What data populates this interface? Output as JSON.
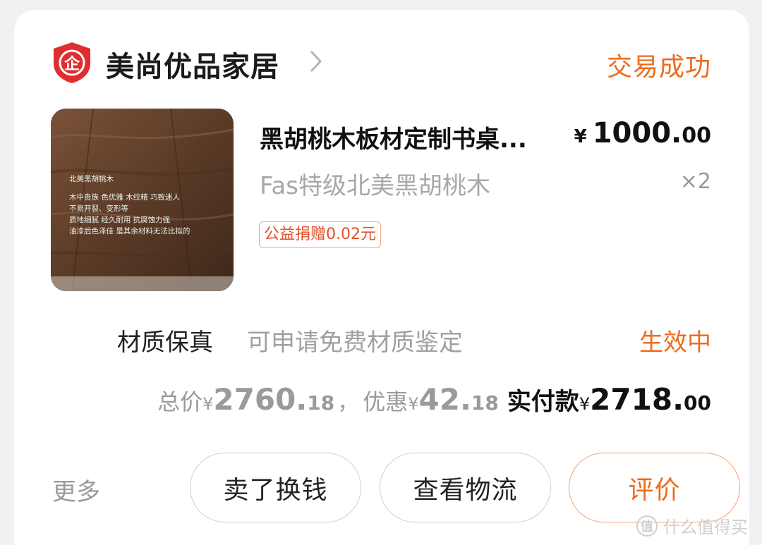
{
  "shop": {
    "name": "美尚优品家居",
    "badge_text": "企",
    "badge_color": "#e02e2e"
  },
  "order": {
    "status": "交易成功",
    "accent_color": "#ee6b1c"
  },
  "product": {
    "title": "黑胡桃木板材定制书桌...",
    "price_symbol": "¥",
    "price_integer": "1000.",
    "price_decimal": "00",
    "spec": "Fas特级北美黑胡桃木",
    "quantity": "×2",
    "charity_tag": "公益捐赠0.02元",
    "image_overlay_lines": [
      "北美黑胡桃木",
      "",
      "木中贵族 色优雅 木纹精 巧致迷人",
      "不易开裂、变形等",
      "质地细腻 经久耐用 抗腐蚀力强",
      "油漆后色泽佳 是其余材料无法比拟的"
    ]
  },
  "guarantee": {
    "label": "材质保真",
    "description": "可申请免费材质鉴定",
    "status": "生效中"
  },
  "totals": {
    "total_label": "总价",
    "total_int": "2760.",
    "total_dec": "18",
    "separator": "，",
    "discount_label": "优惠",
    "discount_int": "42.",
    "discount_dec": "18",
    "paid_label": "实付款",
    "paid_int": "2718.",
    "paid_dec": "00",
    "currency": "¥"
  },
  "actions": {
    "more": "更多",
    "sell": "卖了换钱",
    "logistics": "查看物流",
    "review": "评价"
  },
  "watermark": {
    "badge": "值",
    "text": "什么值得买"
  }
}
